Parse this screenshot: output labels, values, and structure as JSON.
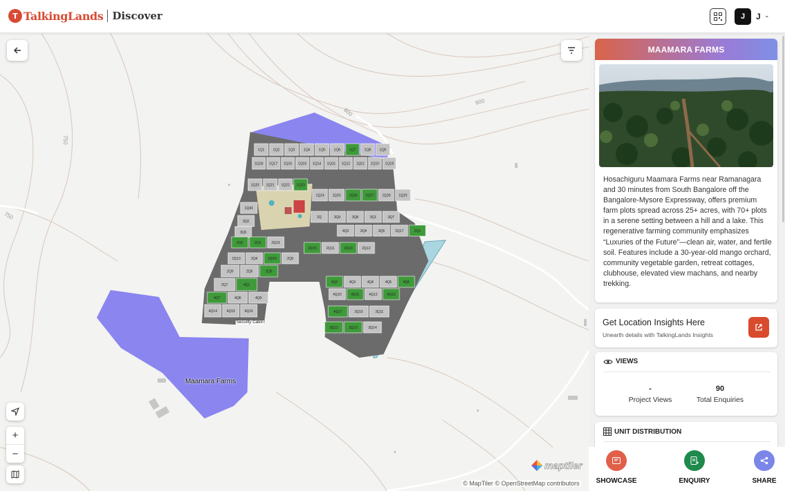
{
  "header": {
    "logo_letter": "T",
    "brand": "TalkingLands",
    "section": "Discover",
    "user_initial": "J",
    "user_name": "J"
  },
  "map": {
    "area_label": "Maamara Farms",
    "contour_labels": [
      "800",
      "800",
      "750",
      "750"
    ],
    "plots": [
      "1Q1",
      "1Q2",
      "1Q3",
      "1Q4",
      "1Q5",
      "1Q6",
      "1Q7",
      "1Q8",
      "1Q9",
      "1Q18",
      "1Q17",
      "1Q16",
      "1Q15",
      "1Q14",
      "1Q31",
      "1Q12",
      "1Q11",
      "1Q10",
      "1Q19",
      "1Q20",
      "1Q21",
      "1Q22",
      "1Q23",
      "1Q24",
      "1Q25",
      "1Q26",
      "1Q27",
      "1Q28",
      "1Q29",
      "1Q30",
      "2Q",
      "3Q9",
      "3Q8",
      "3Q1",
      "3Q7",
      "3Q2",
      "3Q6",
      "4Q3",
      "3Q4",
      "3Q5",
      "2Q17",
      "2Q1",
      "2Q2",
      "2Q3",
      "2Q16",
      "2Q15",
      "2Q11",
      "2Q14",
      "2Q12",
      "2Q13",
      "2Q4",
      "2Q10",
      "2Q5",
      "2Q9",
      "2Q6",
      "2Q8",
      "2Q7",
      "4Q1",
      "4Q2",
      "4Q3",
      "4Q4",
      "4Q5",
      "4Q6",
      "4Q7",
      "4Q8",
      "4Q9",
      "4Q10",
      "4Q11",
      "4Q12",
      "4Q13",
      "4Q14",
      "4Q15",
      "4Q16",
      "4Q17",
      "3Q10",
      "3Q11",
      "3Q12",
      "3Q13",
      "3Q14"
    ],
    "facility_label": "Security Cabin",
    "attribution": "© MapTiler © OpenStreetMap contributors",
    "maptiler_logo": "maptiler",
    "zoom_in": "+",
    "zoom_out": "−"
  },
  "panel": {
    "title": "MAAMARA FARMS",
    "description": "Hosachiguru Maamara Farms near Ramanagara and 30 minutes from South Bangalore off the Bangalore-Mysore Expressway, offers premium farm plots spread across 25+ acres, with 70+ plots in a serene setting between a hill and a lake. This regenerative farming community emphasizes “Luxuries of the Future”—clean air, water, and fertile soil. Features include a 30-year-old mango orchard, community vegetable garden, retreat cottages, clubhouse, elevated view machans, and nearby trekking.",
    "insights": {
      "title": "Get Location Insights Here",
      "subtitle": "Unearth details with TalkingLands Insights"
    },
    "views": {
      "heading": "VIEWS",
      "project_views_value": "-",
      "project_views_label": "Project Views",
      "enquiries_value": "90",
      "enquiries_label": "Total Enquiries"
    },
    "units": {
      "heading": "UNIT DISTRIBUTION"
    },
    "actions": [
      {
        "label": "SHOWCASE",
        "color": "#e0604a"
      },
      {
        "label": "ENQUIRY",
        "color": "#1f8a4c"
      },
      {
        "label": "SHARE",
        "color": "#7b86e8"
      }
    ]
  },
  "colors": {
    "brand": "#d94a34",
    "sold_plot": "#3f9a3a",
    "available_plot": "#c3c3c3",
    "water": "#8a85ef",
    "road": "#666666"
  }
}
